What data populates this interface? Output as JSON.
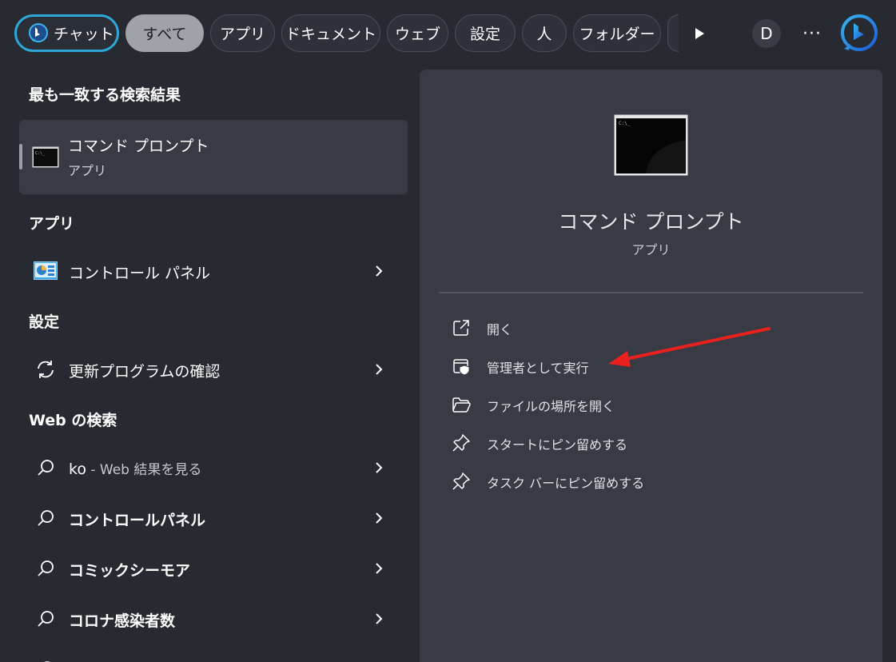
{
  "filters": {
    "chat": "チャット",
    "all": "すべて",
    "apps": "アプリ",
    "documents": "ドキュメント",
    "web": "ウェブ",
    "settings": "設定",
    "people": "人",
    "folders": "フォルダー",
    "avatar_letter": "D",
    "more": "···"
  },
  "left": {
    "best_match_title": "最も一致する検索結果",
    "best_match": {
      "name": "コマンド プロンプト",
      "type": "アプリ",
      "icon": "command-prompt-icon"
    },
    "apps_title": "アプリ",
    "apps": [
      {
        "label": "コントロール パネル",
        "icon": "control-panel-icon"
      }
    ],
    "settings_title": "設定",
    "settings": [
      {
        "label": "更新プログラムの確認",
        "icon": "sync-icon"
      }
    ],
    "web_title": "Web の検索",
    "web": [
      {
        "label": "ko",
        "suffix": " - Web 結果を見る"
      },
      {
        "label": "コントロールパネル"
      },
      {
        "label": "コミックシーモア"
      },
      {
        "label": "コロナ感染者数"
      }
    ]
  },
  "panel": {
    "title": "コマンド プロンプト",
    "subtitle": "アプリ",
    "actions": [
      {
        "label": "開く",
        "icon": "open-external-icon"
      },
      {
        "label": "管理者として実行",
        "icon": "shield-admin-icon"
      },
      {
        "label": "ファイルの場所を開く",
        "icon": "folder-icon"
      },
      {
        "label": "スタートにピン留めする",
        "icon": "pin-icon"
      },
      {
        "label": "タスク バーにピン留めする",
        "icon": "pin-icon"
      }
    ]
  },
  "colors": {
    "background": "#272a31",
    "panel": "#383b43",
    "chat_border": "#2fa7d6",
    "active_pill": "#9fa3a8",
    "annotation_arrow": "#e8201e"
  }
}
